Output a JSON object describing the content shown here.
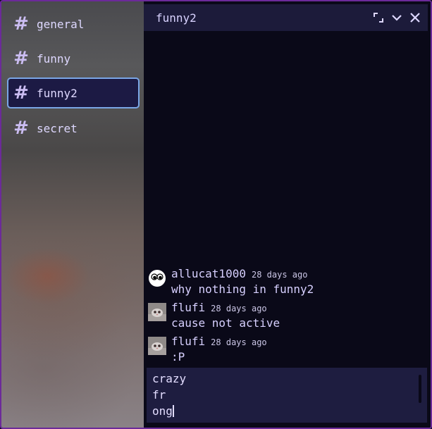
{
  "sidebar": {
    "channels": [
      {
        "hash": "#",
        "label": "general"
      },
      {
        "hash": "#",
        "label": "funny"
      },
      {
        "hash": "#",
        "label": "funny2"
      },
      {
        "hash": "#",
        "label": "secret"
      }
    ],
    "active_channel": "funny2"
  },
  "header": {
    "title": "funny2",
    "icons": [
      "resize-icon",
      "chevron-down-icon",
      "close-icon"
    ]
  },
  "messages": [
    {
      "author": "allucat1000",
      "time": "28 days ago",
      "text": "why nothing in funny2",
      "avatar": "white-ghost-avatar"
    },
    {
      "author": "flufi",
      "time": "28 days ago",
      "text": "cause not active",
      "avatar": "cat-photo-avatar"
    },
    {
      "author": "flufi",
      "time": "28 days ago",
      "text": ":P",
      "avatar": "cat-photo-avatar"
    }
  ],
  "composer": {
    "lines": [
      "crazy",
      "fr",
      "ong"
    ]
  },
  "colors": {
    "background": "#0a0918",
    "sidebar_active_bg": "#1c1a44",
    "sidebar_active_border": "#7aa6e6",
    "topbar_bg": "#1c1b3a",
    "window_border": "#6c2a9a",
    "text": "#d7d0ff"
  }
}
